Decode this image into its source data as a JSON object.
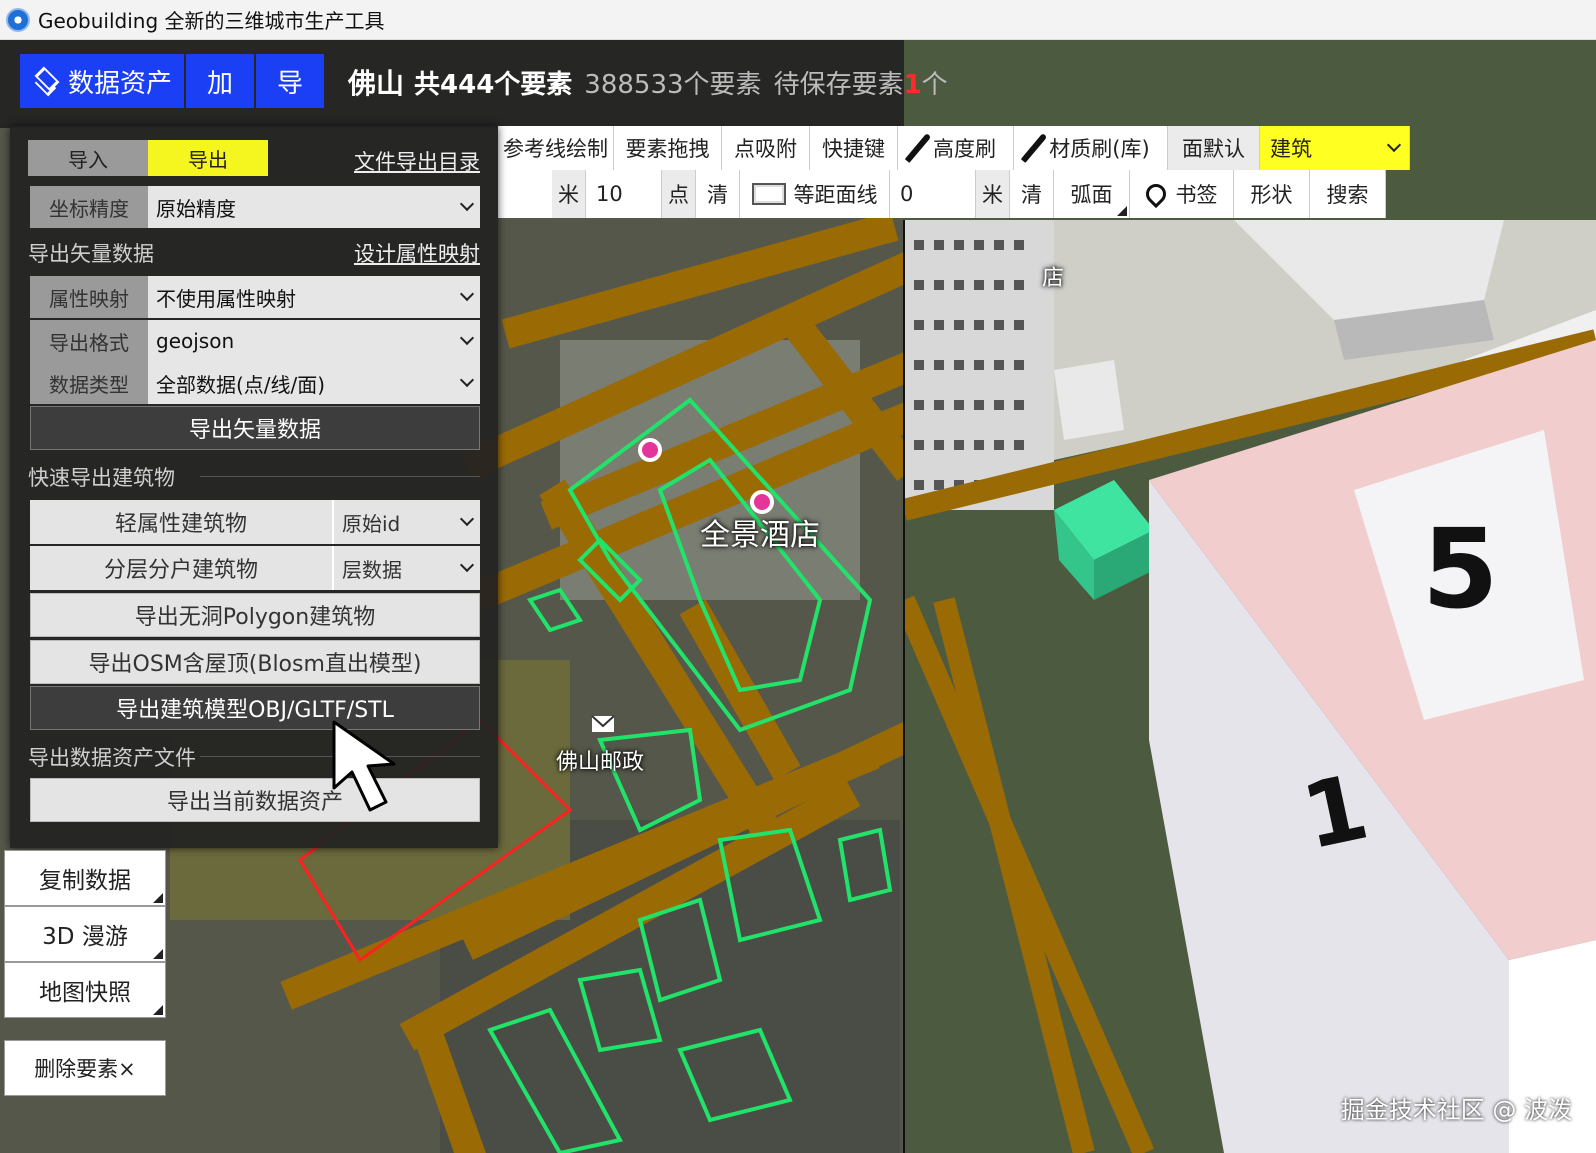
{
  "titlebar": {
    "title": "Geobuilding 全新的三维城市生产工具"
  },
  "header": {
    "assets_label": "数据资产",
    "add_label": "加",
    "export_label": "导",
    "city": "佛山",
    "feature_count": "共444个要素",
    "total_features": "388533个要素",
    "pending_prefix": "待保存要素",
    "pending_count": "1",
    "pending_suffix": "个"
  },
  "toolbar": {
    "row1": {
      "reference_line": "参考线绘制",
      "drag_feature": "要素拖拽",
      "snap": "点吸附",
      "shortcuts": "快捷键",
      "height_brush": "高度刷",
      "material_brush": "材质刷(库)",
      "face_default": "面默认",
      "feature_type": "建筑"
    },
    "row2": {
      "unit_meter": "米",
      "point_value": "10",
      "point_label": "点",
      "clear": "清",
      "contour": "等距面线",
      "contour_value": "0",
      "unit_meter2": "米",
      "clear2": "清",
      "arc_face": "弧面",
      "bookmark": "书签",
      "shape": "形状",
      "search": "搜索"
    }
  },
  "panel": {
    "tab_import": "导入",
    "tab_export": "导出",
    "file_export_dir": "文件导出目录",
    "coord_precision_label": "坐标精度",
    "coord_precision_value": "原始精度",
    "section_vector": "导出矢量数据",
    "design_mapping": "设计属性映射",
    "attr_mapping_label": "属性映射",
    "attr_mapping_value": "不使用属性映射",
    "format_label": "导出格式",
    "format_value": "geojson",
    "data_type_label": "数据类型",
    "data_type_value": "全部数据(点/线/面)",
    "export_vector_btn": "导出矢量数据",
    "section_buildings": "快速导出建筑物",
    "light_attr_btn": "轻属性建筑物",
    "light_attr_select": "原始id",
    "layered_btn": "分层分户建筑物",
    "layered_select": "层数据",
    "no_hole_btn": "导出无洞Polygon建筑物",
    "osm_btn": "导出OSM含屋顶(Blosm直出模型)",
    "model_btn": "导出建筑模型OBJ/GLTF/STL",
    "section_asset": "导出数据资产文件",
    "export_asset_btn": "导出当前数据资产"
  },
  "sidebar": {
    "copy_data": "复制数据",
    "roam_3d": "3D 漫游",
    "map_snapshot": "地图快照",
    "delete_feature": "删除要素×"
  },
  "map": {
    "hotel_label": "全景酒店",
    "post_office_label": "佛山邮政",
    "building_number_5": "5",
    "building_number_1": "1",
    "shop_fragment": "店"
  },
  "watermark": "掘金技术社区 @ 波泼",
  "colors": {
    "accent_blue": "#1b3ff5",
    "export_yellow": "#f5f51f",
    "road_brown": "#9a6b05",
    "outline_green": "#22e36a",
    "poi_pink": "#e6359a",
    "pending_red": "#ff2a2a"
  }
}
